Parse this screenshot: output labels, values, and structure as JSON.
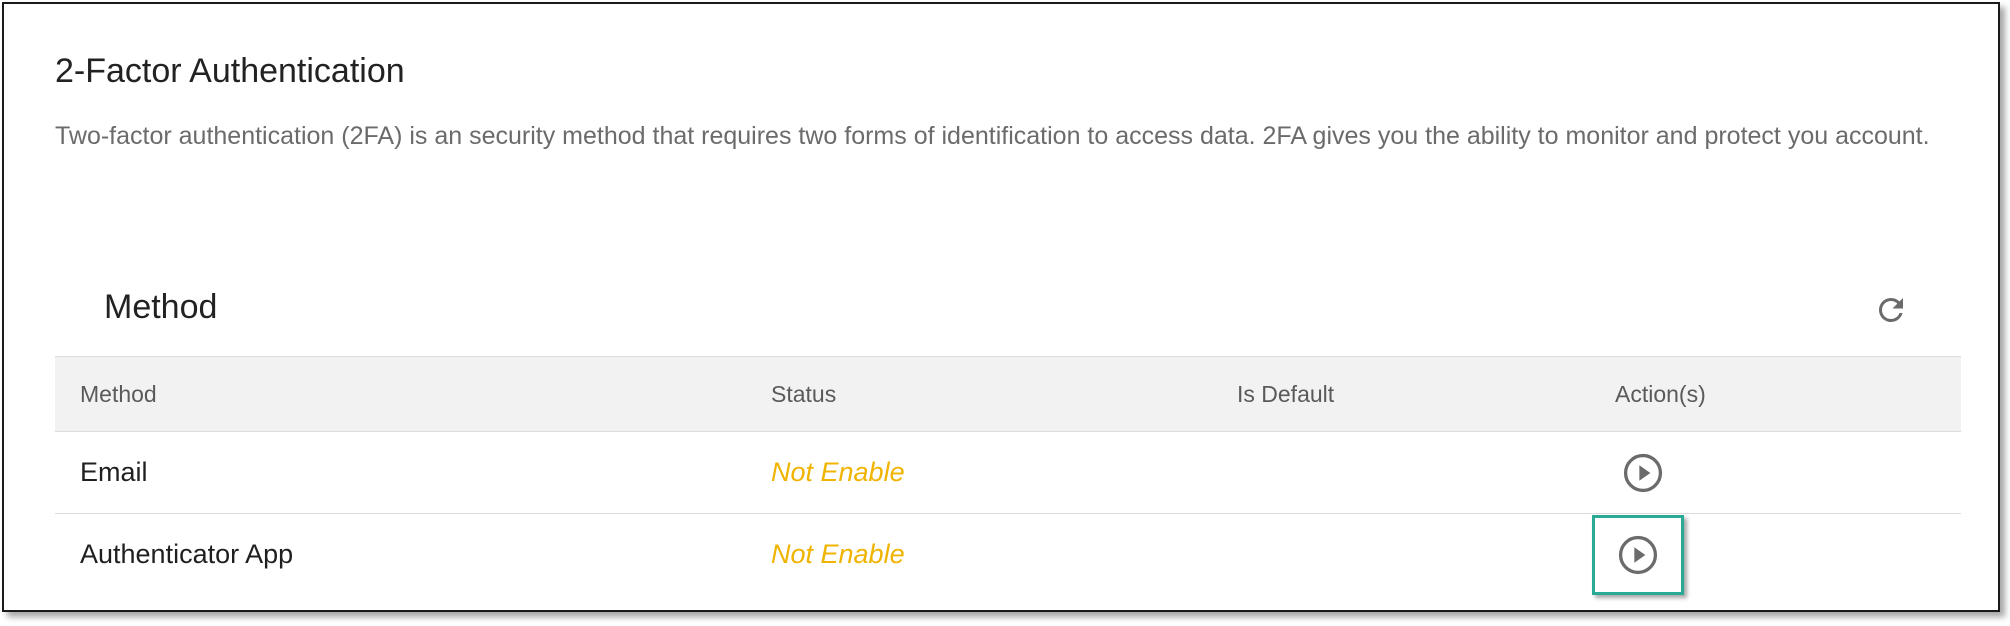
{
  "page": {
    "title": "2-Factor Authentication",
    "description": "Two-factor authentication (2FA) is an security method that requires two forms of identification to access data. 2FA gives you the ability to monitor and protect you account."
  },
  "section": {
    "title": "Method",
    "refresh_icon": "refresh-icon"
  },
  "table": {
    "headers": [
      "Method",
      "Status",
      "Is Default",
      "Action(s)"
    ],
    "rows": [
      {
        "method": "Email",
        "status": "Not Enable",
        "is_default": "",
        "action_icon": "play-circle-icon"
      },
      {
        "method": "Authenticator App",
        "status": "Not Enable",
        "is_default": "",
        "action_icon": "play-circle-icon"
      }
    ]
  },
  "colors": {
    "status_not_enabled": "#f0b400",
    "highlight": "#2aaa94",
    "header_bg": "#f2f2f2",
    "icon": "#6b6b6b"
  }
}
